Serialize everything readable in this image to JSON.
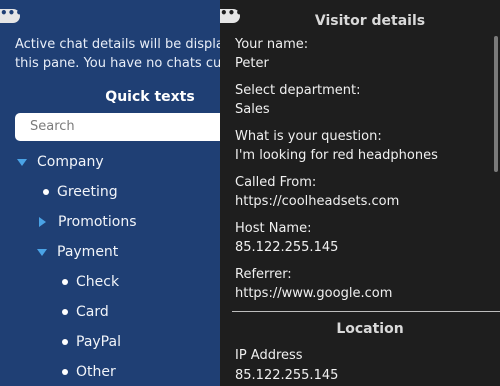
{
  "left_pane": {
    "menu_label": "•••",
    "info_line1": "Active chat details will be displa",
    "info_line2": "this pane. You have no chats cur",
    "quick_texts_title": "Quick texts",
    "search_placeholder": "Search",
    "tree": {
      "company": "Company",
      "greeting": "Greeting",
      "promotions": "Promotions",
      "payment": "Payment",
      "check": "Check",
      "card": "Card",
      "paypal": "PayPal",
      "other": "Other"
    }
  },
  "right_pane": {
    "menu_label": "•••",
    "visitor_details_title": "Visitor details",
    "fields": {
      "name_label": "Your name:",
      "name_value": "Peter",
      "dept_label": "Select department:",
      "dept_value": "Sales",
      "question_label": "What is your question:",
      "question_value": "I'm looking for red headphones",
      "called_from_label": "Called From:",
      "called_from_value": "https://coolheadsets.com",
      "host_label": "Host Name:",
      "host_value": "85.122.255.145",
      "referrer_label": "Referrer:",
      "referrer_value": "https://www.google.com"
    },
    "location_title": "Location",
    "ip_label": "IP Address",
    "ip_value": "85.122.255.145"
  },
  "colors": {
    "left_bg": "#1f3f74",
    "right_bg": "#1e1e1e",
    "accent": "#4aa3e6"
  }
}
